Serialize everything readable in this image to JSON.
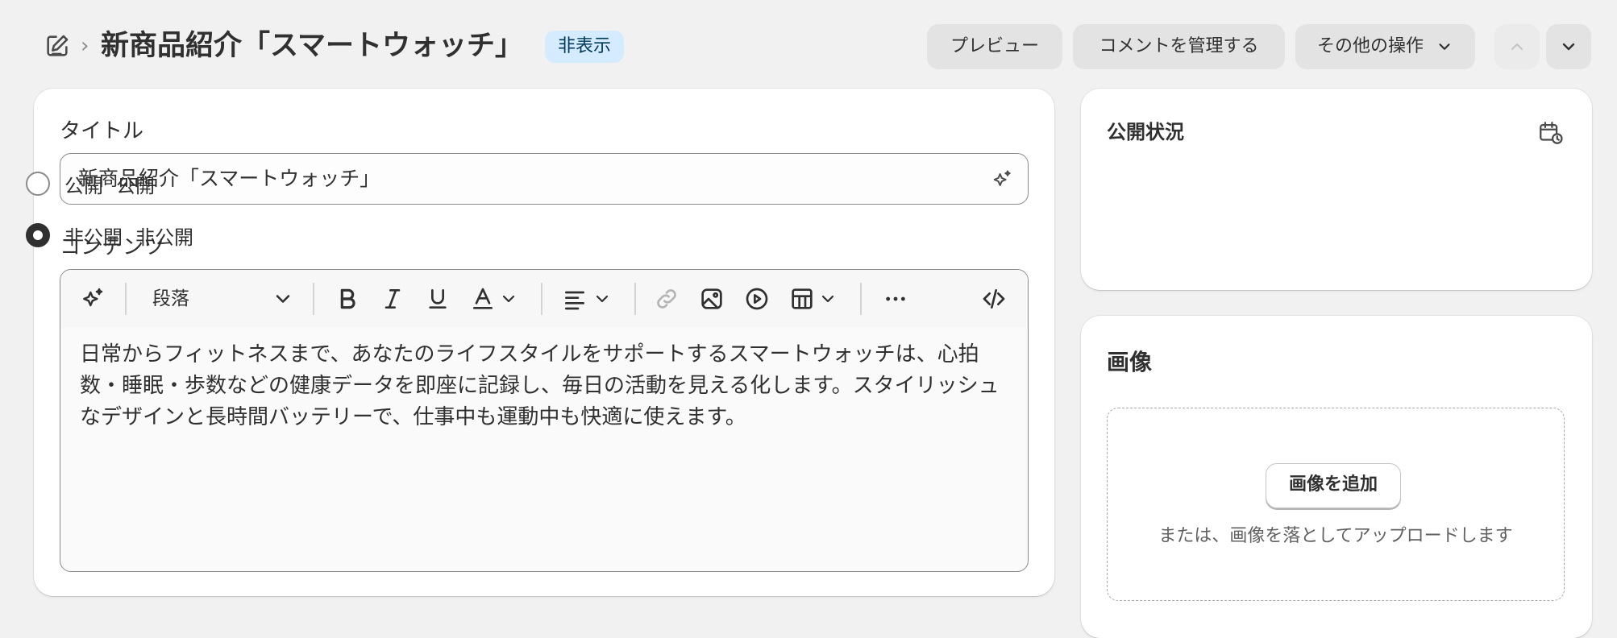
{
  "header": {
    "breadcrumb_separator": "›",
    "title": "新商品紹介「スマートウォッチ」",
    "status_badge": "非表示",
    "buttons": {
      "preview": "プレビュー",
      "manage_comments": "コメントを管理する",
      "more_actions": "その他の操作"
    }
  },
  "main": {
    "title_label": "タイトル",
    "title_value": "新商品紹介「スマートウォッチ」",
    "content_label": "コンテンツ",
    "toolbar": {
      "paragraph_select": "段落"
    },
    "content_text": "日常からフィットネスまで、あなたのライフスタイルをサポートするスマートウォッチは、心拍数・睡眠・歩数などの健康データを即座に記録し、毎日の活動を見える化します。スタイリッシュなデザインと長時間バッテリーで、仕事中も運動中も快適に使えます。"
  },
  "visibility": {
    "heading": "公開状況",
    "options": [
      {
        "label": "公開",
        "sub": "公開",
        "checked": false
      },
      {
        "label": "非公開",
        "sub": "非公開",
        "checked": true
      }
    ]
  },
  "images": {
    "heading": "画像",
    "add_button": "画像を追加",
    "drop_hint": "または、画像を落としてアップロードします"
  },
  "colors": {
    "badge_bg": "#d5ebff",
    "page_bg": "#f1f1f1",
    "text": "#303030"
  }
}
